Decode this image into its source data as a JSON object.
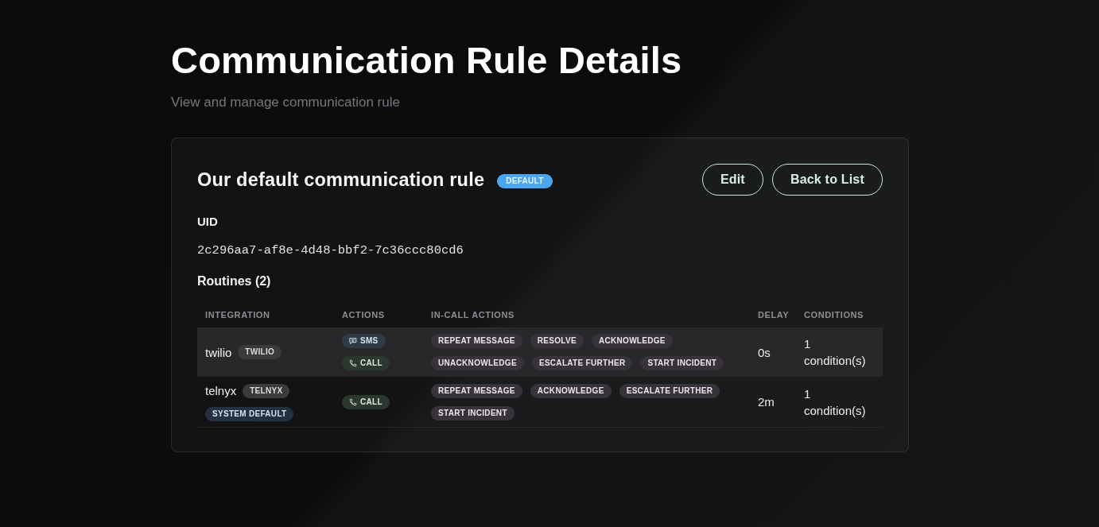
{
  "page": {
    "title": "Communication Rule Details",
    "subtitle": "View and manage communication rule"
  },
  "rule": {
    "name": "Our default communication rule",
    "badge": "DEFAULT",
    "buttons": [
      {
        "label": "Edit"
      },
      {
        "label": "Back to List"
      }
    ],
    "uid_label": "UID",
    "uid": "2c296aa7-af8e-4d48-bbf2-7c36ccc80cd6"
  },
  "routines": {
    "title": "Routines (2)",
    "columns": [
      "INTEGRATION",
      "ACTIONS",
      "IN-CALL ACTIONS",
      "DELAY",
      "CONDITIONS"
    ],
    "rows": [
      {
        "highlighted": true,
        "integration": "twilio",
        "badges": [
          {
            "kind": "provider",
            "label": "TWILIO"
          }
        ],
        "actions": [
          {
            "kind": "sms",
            "label": "SMS"
          },
          {
            "kind": "call",
            "label": "CALL"
          }
        ],
        "in_call_actions": [
          "REPEAT MESSAGE",
          "RESOLVE",
          "ACKNOWLEDGE",
          "UNACKNOWLEDGE",
          "ESCALATE FURTHER",
          "START INCIDENT"
        ],
        "delay": "0s",
        "conditions": "1 condition(s)"
      },
      {
        "highlighted": false,
        "integration": "telnyx",
        "badges": [
          {
            "kind": "provider",
            "label": "TELNYX"
          },
          {
            "kind": "system",
            "label": "SYSTEM DEFAULT"
          }
        ],
        "actions": [
          {
            "kind": "call",
            "label": "CALL"
          }
        ],
        "in_call_actions": [
          "REPEAT MESSAGE",
          "ACKNOWLEDGE",
          "ESCALATE FURTHER",
          "START INCIDENT"
        ],
        "delay": "2m",
        "conditions": "1 condition(s)"
      }
    ]
  }
}
